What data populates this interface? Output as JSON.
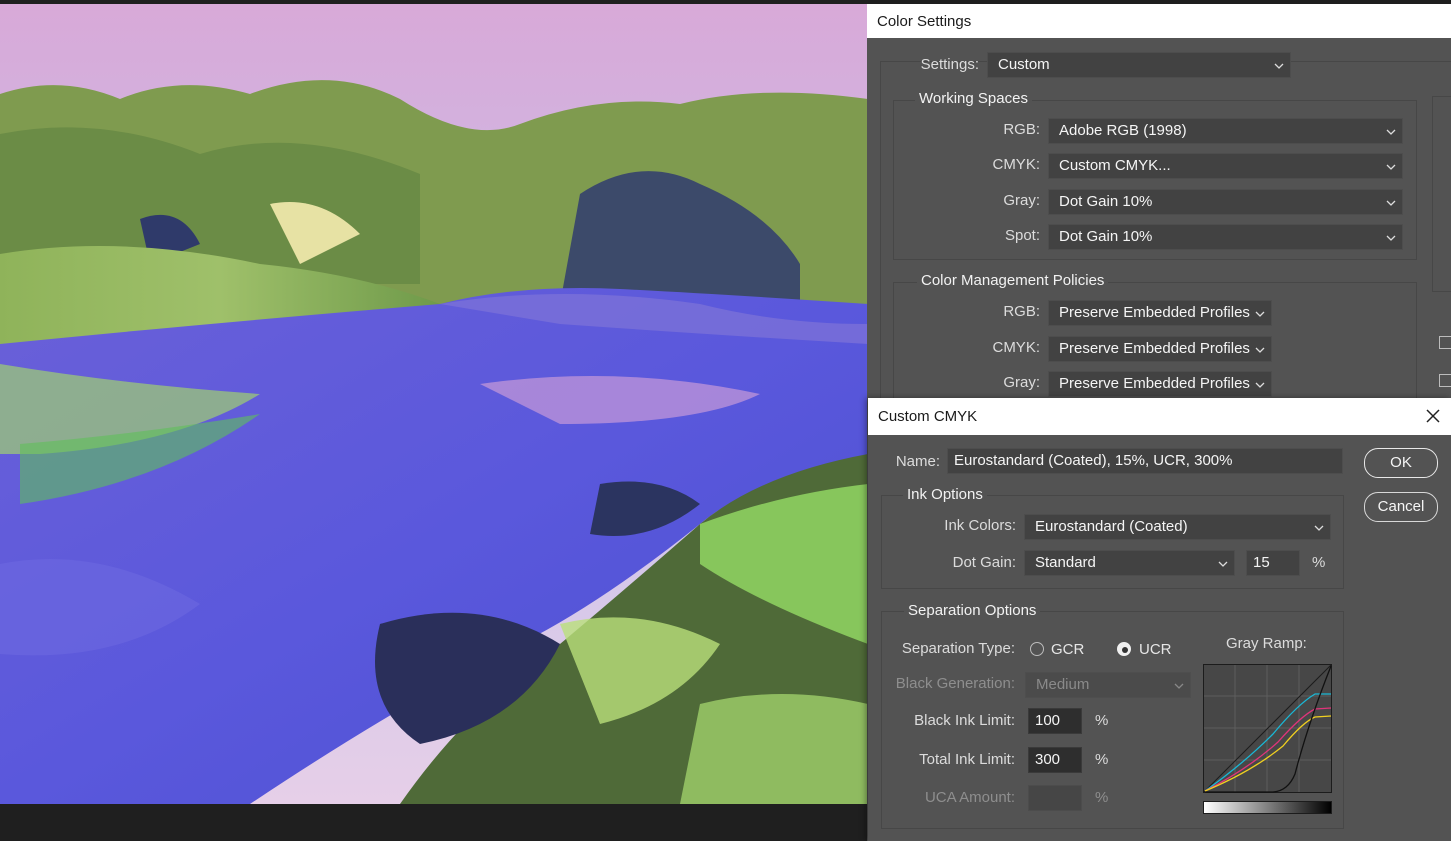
{
  "color_settings": {
    "title": "Color Settings",
    "settings_label": "Settings:",
    "settings_value": "Custom",
    "working_spaces": {
      "label": "Working Spaces",
      "rgb_label": "RGB:",
      "rgb_value": "Adobe RGB (1998)",
      "cmyk_label": "CMYK:",
      "cmyk_value": "Custom CMYK...",
      "gray_label": "Gray:",
      "gray_value": "Dot Gain 10%",
      "spot_label": "Spot:",
      "spot_value": "Dot Gain 10%"
    },
    "policies": {
      "label": "Color Management Policies",
      "rgb_label": "RGB:",
      "rgb_value": "Preserve Embedded Profiles",
      "cmyk_label": "CMYK:",
      "cmyk_value": "Preserve Embedded Profiles",
      "gray_label": "Gray:",
      "gray_value": "Preserve Embedded Profiles"
    }
  },
  "custom_cmyk": {
    "title": "Custom CMYK",
    "name_label": "Name:",
    "name_value": "Eurostandard (Coated), 15%, UCR, 300%",
    "ok_label": "OK",
    "cancel_label": "Cancel",
    "ink_options": {
      "label": "Ink Options",
      "ink_colors_label": "Ink Colors:",
      "ink_colors_value": "Eurostandard (Coated)",
      "dot_gain_label": "Dot Gain:",
      "dot_gain_value": "Standard",
      "dot_gain_amount": "15",
      "percent": "%"
    },
    "separation": {
      "label": "Separation Options",
      "type_label": "Separation Type:",
      "gcr_label": "GCR",
      "ucr_label": "UCR",
      "selected": "UCR",
      "black_gen_label": "Black Generation:",
      "black_gen_value": "Medium",
      "black_ink_label": "Black Ink Limit:",
      "black_ink_value": "100",
      "total_ink_label": "Total Ink Limit:",
      "total_ink_value": "300",
      "uca_label": "UCA Amount:",
      "uca_value": "",
      "percent": "%",
      "gray_ramp_label": "Gray Ramp:"
    }
  },
  "colors": {
    "dialog_bg": "#535353",
    "ramp_cyan": "#19b8d6",
    "ramp_magenta": "#e0347a",
    "ramp_yellow": "#f0d020",
    "ramp_black": "#111111"
  }
}
